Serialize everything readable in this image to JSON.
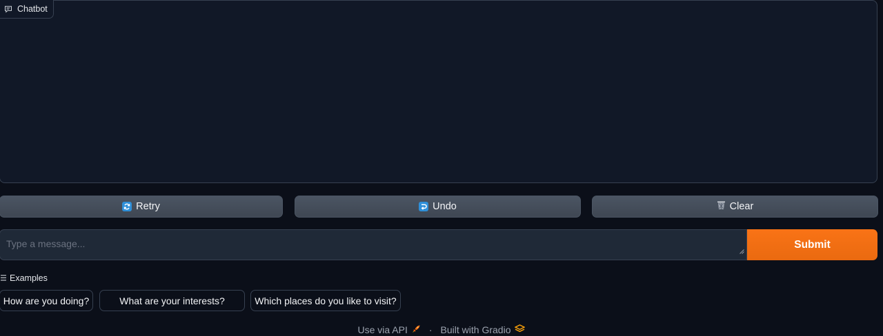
{
  "chatbot": {
    "label": "Chatbot",
    "icon": "chat-icon"
  },
  "buttons": {
    "retry": {
      "label": "Retry",
      "icon": "retry-icon"
    },
    "undo": {
      "label": "Undo",
      "icon": "undo-icon"
    },
    "clear": {
      "label": "Clear",
      "icon": "wastebasket-icon"
    }
  },
  "input": {
    "placeholder": "Type a message...",
    "value": ""
  },
  "submit": {
    "label": "Submit"
  },
  "examples": {
    "label": "Examples",
    "items": [
      "How are you doing?",
      "What are your interests?",
      "Which places do you like to visit?"
    ]
  },
  "footer": {
    "api_label": "Use via API",
    "separator": "·",
    "built_label": "Built with Gradio"
  },
  "colors": {
    "background": "#0b0f19",
    "panel": "#111827",
    "button": "#4b5563",
    "accent": "#f97316"
  }
}
